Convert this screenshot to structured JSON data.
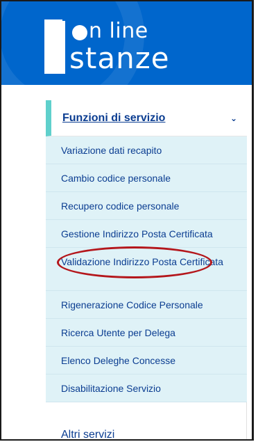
{
  "header": {
    "logo_top": "n line",
    "logo_bottom": "stanze"
  },
  "menu": {
    "title": "Funzioni di servizio",
    "expand_icon": "chevron-down-icon",
    "items": [
      {
        "label": "Variazione dati recapito"
      },
      {
        "label": "Cambio codice personale"
      },
      {
        "label": "Recupero codice personale"
      },
      {
        "label": "Gestione Indirizzo Posta Certificata"
      },
      {
        "label": "Validazione Indirizzo Posta Certificata"
      },
      {
        "label": "Rigenerazione Codice Personale"
      },
      {
        "label": "Ricerca Utente per Delega"
      },
      {
        "label": "Elenco Deleghe Concesse"
      },
      {
        "label": "Disabilitazione Servizio"
      }
    ]
  },
  "other_services": {
    "label": "Altri servizi"
  },
  "colors": {
    "header_bg": "#0066cc",
    "accent": "#5fd0cc",
    "submenu_bg": "#dff2f7",
    "link": "#0b3d91",
    "highlight": "#b4161b"
  }
}
